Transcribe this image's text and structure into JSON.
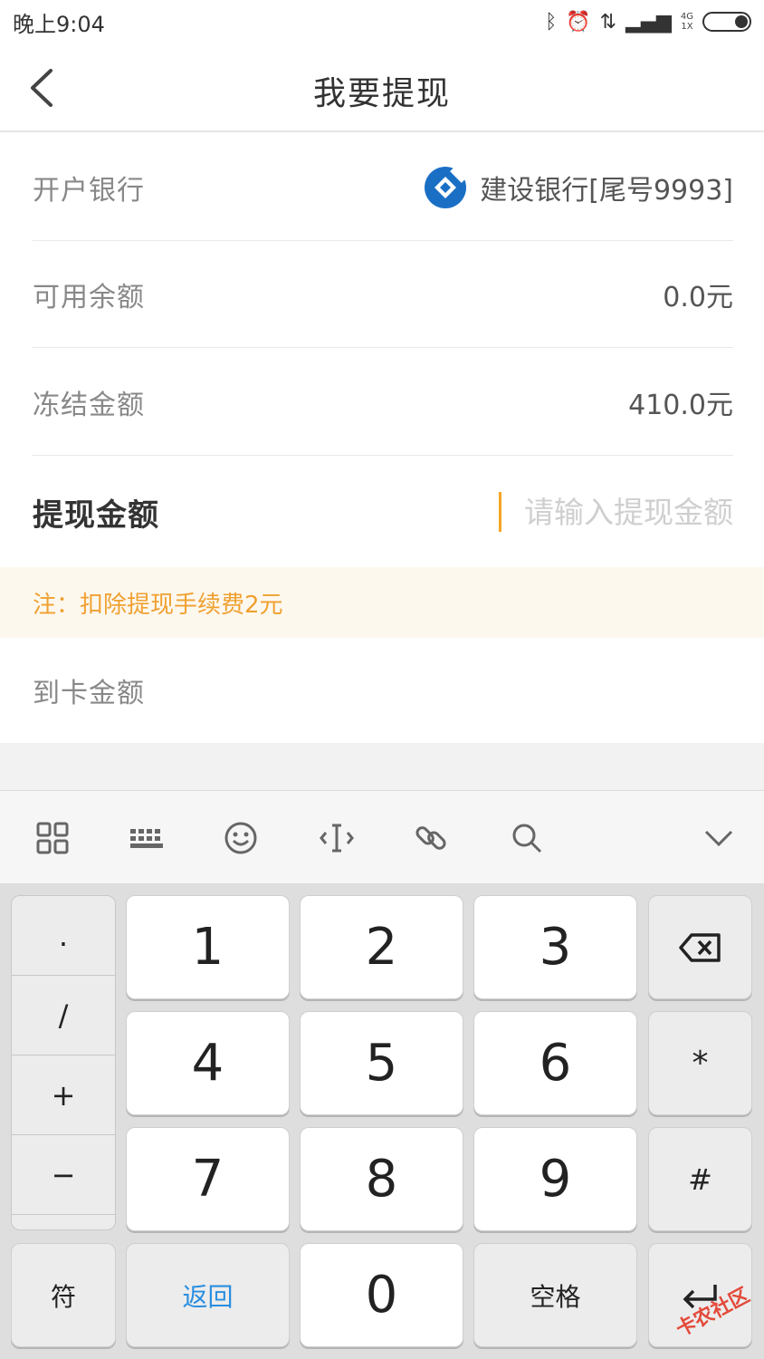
{
  "status_bar": {
    "time": "晚上9:04",
    "network_top": "4G",
    "network_bottom": "1X"
  },
  "nav": {
    "title": "我要提现"
  },
  "form": {
    "bank": {
      "label": "开户银行",
      "value": "建设银行[尾号9993]",
      "logo_color": "#1a6fc4"
    },
    "available": {
      "label": "可用余额",
      "value": "0.0元"
    },
    "frozen": {
      "label": "冻结金额",
      "value": "410.0元"
    },
    "withdraw": {
      "label": "提现金额",
      "placeholder": "请输入提现金额"
    },
    "notice": "注：扣除提现手续费2元",
    "arrive": {
      "label": "到卡金额"
    }
  },
  "keyboard": {
    "toolbar_icons": [
      "grid-icon",
      "keyboard-icon",
      "emoji-icon",
      "cursor-icon",
      "link-icon",
      "search-icon",
      "collapse-icon"
    ],
    "side_keys": [
      ".",
      "/",
      "+",
      "−"
    ],
    "digits": [
      "1",
      "2",
      "3",
      "4",
      "5",
      "6",
      "7",
      "8",
      "9",
      "0"
    ],
    "right_keys": {
      "star": "*",
      "hash": "#"
    },
    "bottom": {
      "symbols": "符",
      "back": "返回",
      "space": "空格"
    },
    "accent_color": "#2a8ee0"
  },
  "watermark": "卡农社区"
}
